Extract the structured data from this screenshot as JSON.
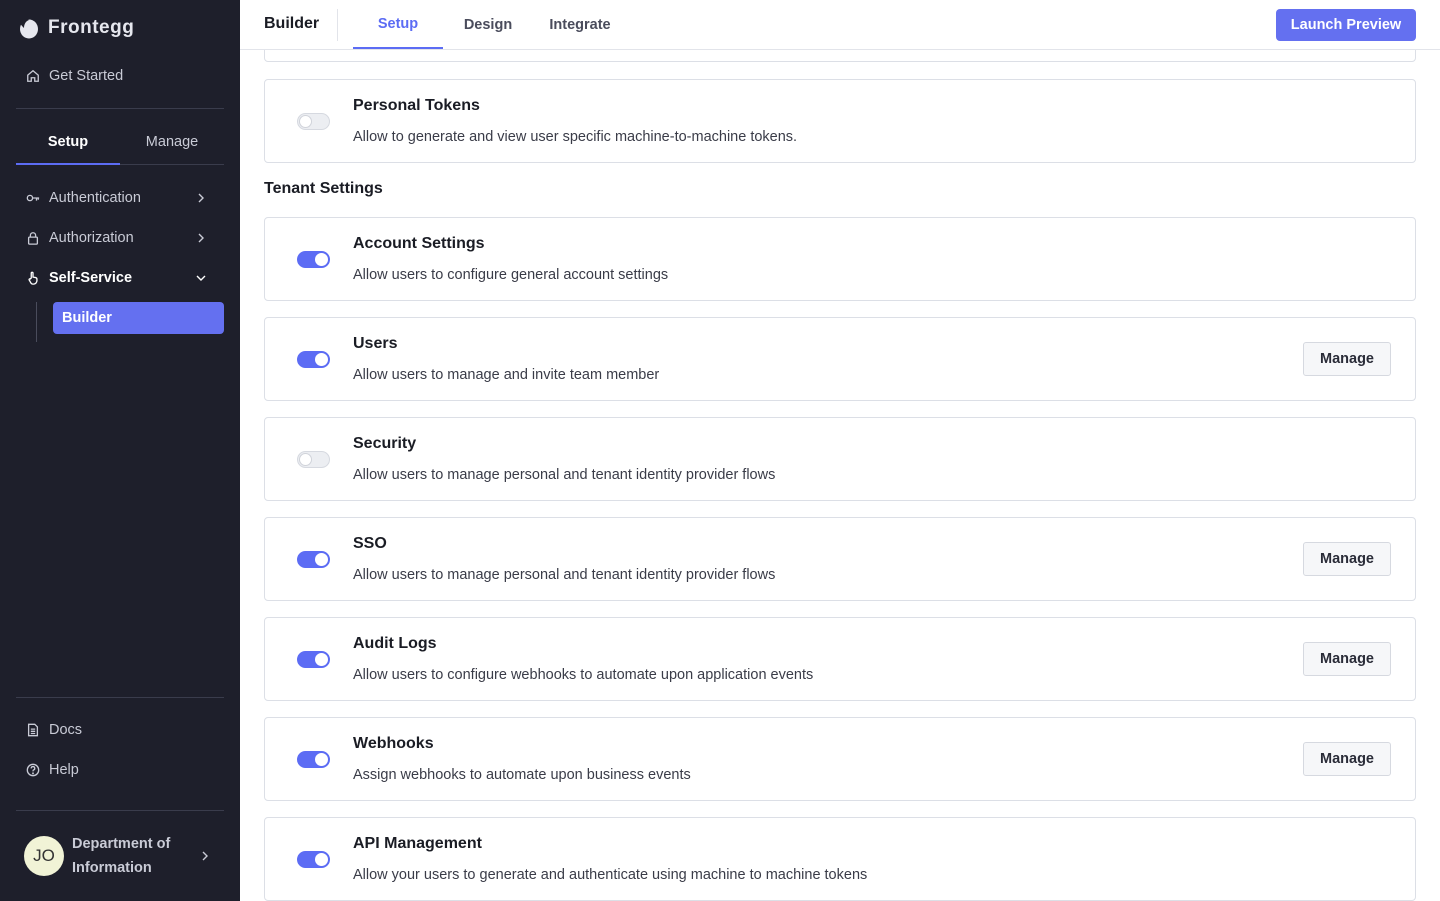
{
  "sidebar": {
    "brand": "Frontegg",
    "get_started": "Get Started",
    "tabs": [
      {
        "label": "Setup",
        "active": true
      },
      {
        "label": "Manage",
        "active": false
      }
    ],
    "nav": {
      "authentication": "Authentication",
      "authorization": "Authorization",
      "self_service": "Self-Service",
      "builder": "Builder"
    },
    "docs": "Docs",
    "help": "Help",
    "user": {
      "initials": "JO",
      "name": "Department of Information"
    }
  },
  "header": {
    "title": "Builder",
    "tabs": [
      {
        "label": "Setup",
        "active": true
      },
      {
        "label": "Design",
        "active": false
      },
      {
        "label": "Integrate",
        "active": false
      }
    ],
    "launch_label": "Launch Preview"
  },
  "content": {
    "section_title": "Tenant Settings",
    "manage_label": "Manage",
    "cards": [
      {
        "title": "Personal Tokens",
        "desc": "Allow to generate and view user specific machine-to-machine tokens.",
        "enabled": false,
        "manage": false
      },
      {
        "title": "Account Settings",
        "desc": "Allow users to configure general account settings",
        "enabled": true,
        "manage": false
      },
      {
        "title": "Users",
        "desc": "Allow users to manage and invite team member",
        "enabled": true,
        "manage": true
      },
      {
        "title": "Security",
        "desc": "Allow users to manage personal and tenant identity provider flows",
        "enabled": false,
        "manage": false
      },
      {
        "title": "SSO",
        "desc": "Allow users to manage personal and tenant identity provider flows",
        "enabled": true,
        "manage": true
      },
      {
        "title": "Audit Logs",
        "desc": "Allow users to configure webhooks to automate upon application events",
        "enabled": true,
        "manage": true
      },
      {
        "title": "Webhooks",
        "desc": "Assign webhooks to automate upon business events",
        "enabled": true,
        "manage": true
      },
      {
        "title": "API Management",
        "desc": "Allow your users to generate and authenticate using machine to machine tokens",
        "enabled": true,
        "manage": false
      }
    ]
  },
  "colors": {
    "accent": "#5c6cf4",
    "sidebar_bg": "#1e1f2b"
  }
}
